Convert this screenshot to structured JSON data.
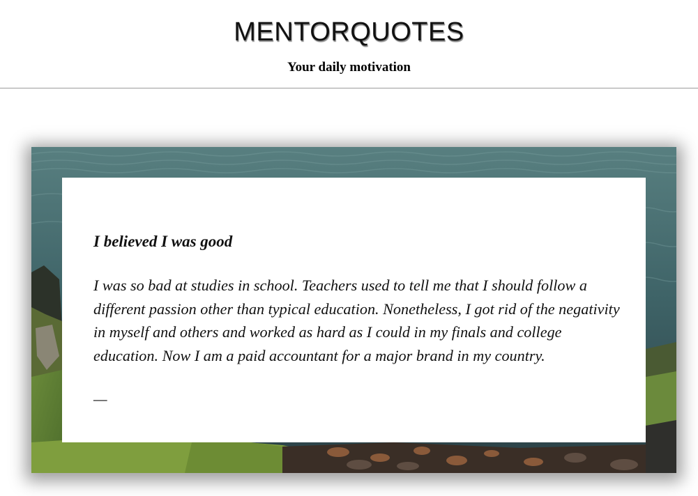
{
  "header": {
    "site_title": "MENTORQUOTES",
    "tagline": "Your daily motivation"
  },
  "quote": {
    "title": "I believed I was good",
    "body": "I was so bad at studies in school. Teachers used to tell me that I should follow a different passion other than typical education. Nonetheless, I got rid of the negativity in myself and others and worked as hard as I could in my finals and college education. Now I am a paid accountant for a major brand in my country.",
    "author": "—"
  },
  "colors": {
    "page_background": "#ffffff",
    "header_divider": "#9a9a9a",
    "text": "#111111",
    "card_background": "#ffffff"
  }
}
